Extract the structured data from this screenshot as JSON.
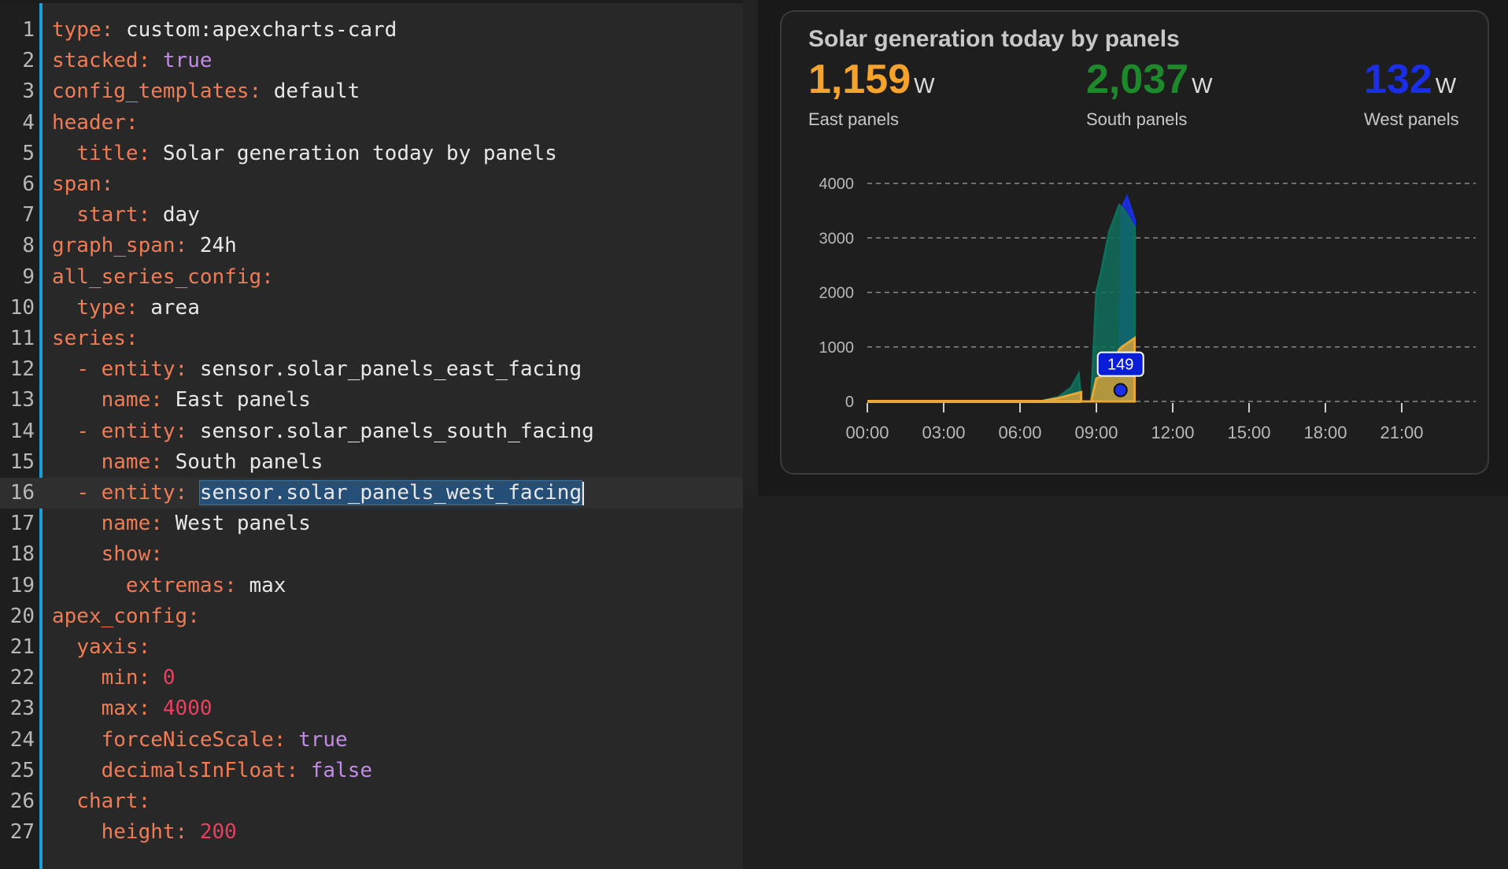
{
  "editor": {
    "lines": [
      {
        "n": "1",
        "key": "type",
        "colon": ": ",
        "value": "custom:apexcharts-card",
        "vtype": "str",
        "indent": ""
      },
      {
        "n": "2",
        "key": "stacked",
        "colon": ": ",
        "value": "true",
        "vtype": "bool",
        "indent": ""
      },
      {
        "n": "3",
        "key": "config_templates",
        "colon": ": ",
        "value": "default",
        "vtype": "str",
        "indent": ""
      },
      {
        "n": "4",
        "key": "header",
        "colon": ":",
        "value": "",
        "vtype": "str",
        "indent": ""
      },
      {
        "n": "5",
        "key": "title",
        "colon": ": ",
        "value": "Solar generation today by panels",
        "vtype": "str",
        "indent": "  "
      },
      {
        "n": "6",
        "key": "span",
        "colon": ":",
        "value": "",
        "vtype": "str",
        "indent": ""
      },
      {
        "n": "7",
        "key": "start",
        "colon": ": ",
        "value": "day",
        "vtype": "str",
        "indent": "  "
      },
      {
        "n": "8",
        "key": "graph_span",
        "colon": ": ",
        "value": "24h",
        "vtype": "str",
        "indent": ""
      },
      {
        "n": "9",
        "key": "all_series_config",
        "colon": ":",
        "value": "",
        "vtype": "str",
        "indent": ""
      },
      {
        "n": "10",
        "key": "type",
        "colon": ": ",
        "value": "area",
        "vtype": "str",
        "indent": "  "
      },
      {
        "n": "11",
        "key": "series",
        "colon": ":",
        "value": "",
        "vtype": "str",
        "indent": ""
      },
      {
        "n": "12",
        "key": "entity",
        "colon": ": ",
        "value": "sensor.solar_panels_east_facing",
        "vtype": "str",
        "indent": "  ",
        "dash": true
      },
      {
        "n": "13",
        "key": "name",
        "colon": ": ",
        "value": "East panels",
        "vtype": "str",
        "indent": "    "
      },
      {
        "n": "14",
        "key": "entity",
        "colon": ": ",
        "value": "sensor.solar_panels_south_facing",
        "vtype": "str",
        "indent": "  ",
        "dash": true
      },
      {
        "n": "15",
        "key": "name",
        "colon": ": ",
        "value": "South panels",
        "vtype": "str",
        "indent": "    "
      },
      {
        "n": "16",
        "key": "entity",
        "colon": ": ",
        "value": "sensor.solar_panels_west_facing",
        "vtype": "str",
        "indent": "  ",
        "dash": true,
        "active": true,
        "selected": true
      },
      {
        "n": "17",
        "key": "name",
        "colon": ": ",
        "value": "West panels",
        "vtype": "str",
        "indent": "    "
      },
      {
        "n": "18",
        "key": "show",
        "colon": ":",
        "value": "",
        "vtype": "str",
        "indent": "    "
      },
      {
        "n": "19",
        "key": "extremas",
        "colon": ": ",
        "value": "max",
        "vtype": "str",
        "indent": "      "
      },
      {
        "n": "20",
        "key": "apex_config",
        "colon": ":",
        "value": "",
        "vtype": "str",
        "indent": ""
      },
      {
        "n": "21",
        "key": "yaxis",
        "colon": ":",
        "value": "",
        "vtype": "str",
        "indent": "  "
      },
      {
        "n": "22",
        "key": "min",
        "colon": ": ",
        "value": "0",
        "vtype": "num",
        "indent": "    "
      },
      {
        "n": "23",
        "key": "max",
        "colon": ": ",
        "value": "4000",
        "vtype": "num",
        "indent": "    "
      },
      {
        "n": "24",
        "key": "forceNiceScale",
        "colon": ": ",
        "value": "true",
        "vtype": "bool",
        "indent": "    "
      },
      {
        "n": "25",
        "key": "decimalsInFloat",
        "colon": ": ",
        "value": "false",
        "vtype": "bool",
        "indent": "    "
      },
      {
        "n": "26",
        "key": "chart",
        "colon": ":",
        "value": "",
        "vtype": "str",
        "indent": "  "
      },
      {
        "n": "27",
        "key": "height",
        "colon": ": ",
        "value": "200",
        "vtype": "num",
        "indent": "    "
      }
    ]
  },
  "card": {
    "title": "Solar generation today by panels",
    "stats": [
      {
        "value": "1,159",
        "unit": "W",
        "name": "East panels",
        "color": "#f5a32a"
      },
      {
        "value": "2,037",
        "unit": "W",
        "name": "South panels",
        "color": "#1c8a2a"
      },
      {
        "value": "132",
        "unit": "W",
        "name": "West panels",
        "color": "#1a2ee8"
      }
    ]
  },
  "chart_data": {
    "type": "area",
    "stacked": true,
    "x_ticks": [
      "00:00",
      "03:00",
      "06:00",
      "09:00",
      "12:00",
      "15:00",
      "18:00",
      "21:00"
    ],
    "y_ticks": [
      "0",
      "1000",
      "2000",
      "3000",
      "4000"
    ],
    "ylim": [
      0,
      4000
    ],
    "xlim_hours": [
      0,
      24
    ],
    "grid": true,
    "series": [
      {
        "name": "East panels",
        "color": "#e8a838",
        "points": [
          [
            0,
            0
          ],
          [
            6.8,
            0
          ],
          [
            7.5,
            60
          ],
          [
            8.4,
            170
          ],
          [
            8.4,
            0
          ],
          [
            8.5,
            0
          ],
          [
            8.8,
            0
          ],
          [
            9.0,
            420
          ],
          [
            9.2,
            460
          ],
          [
            9.6,
            700
          ],
          [
            9.9,
            950
          ],
          [
            10.0,
            1000
          ],
          [
            10.5,
            1159
          ]
        ]
      },
      {
        "name": "South panels",
        "color": "#0f6e5a",
        "points": [
          [
            0,
            0
          ],
          [
            6.8,
            0
          ],
          [
            7.5,
            80
          ],
          [
            8.0,
            250
          ],
          [
            8.3,
            500
          ],
          [
            8.4,
            0
          ],
          [
            8.5,
            0
          ],
          [
            8.8,
            0
          ],
          [
            9.0,
            2000
          ],
          [
            9.2,
            2400
          ],
          [
            9.5,
            3100
          ],
          [
            9.9,
            3600
          ],
          [
            10.1,
            3500
          ],
          [
            10.5,
            3196
          ]
        ]
      },
      {
        "name": "West panels",
        "color": "#1a2ee8",
        "points": [
          [
            0,
            0
          ],
          [
            9.9,
            0
          ],
          [
            10.0,
            3550
          ],
          [
            10.2,
            3750
          ],
          [
            10.5,
            3328
          ]
        ]
      }
    ],
    "annotation": {
      "label": "149",
      "x": 9.95,
      "y": 149
    }
  }
}
